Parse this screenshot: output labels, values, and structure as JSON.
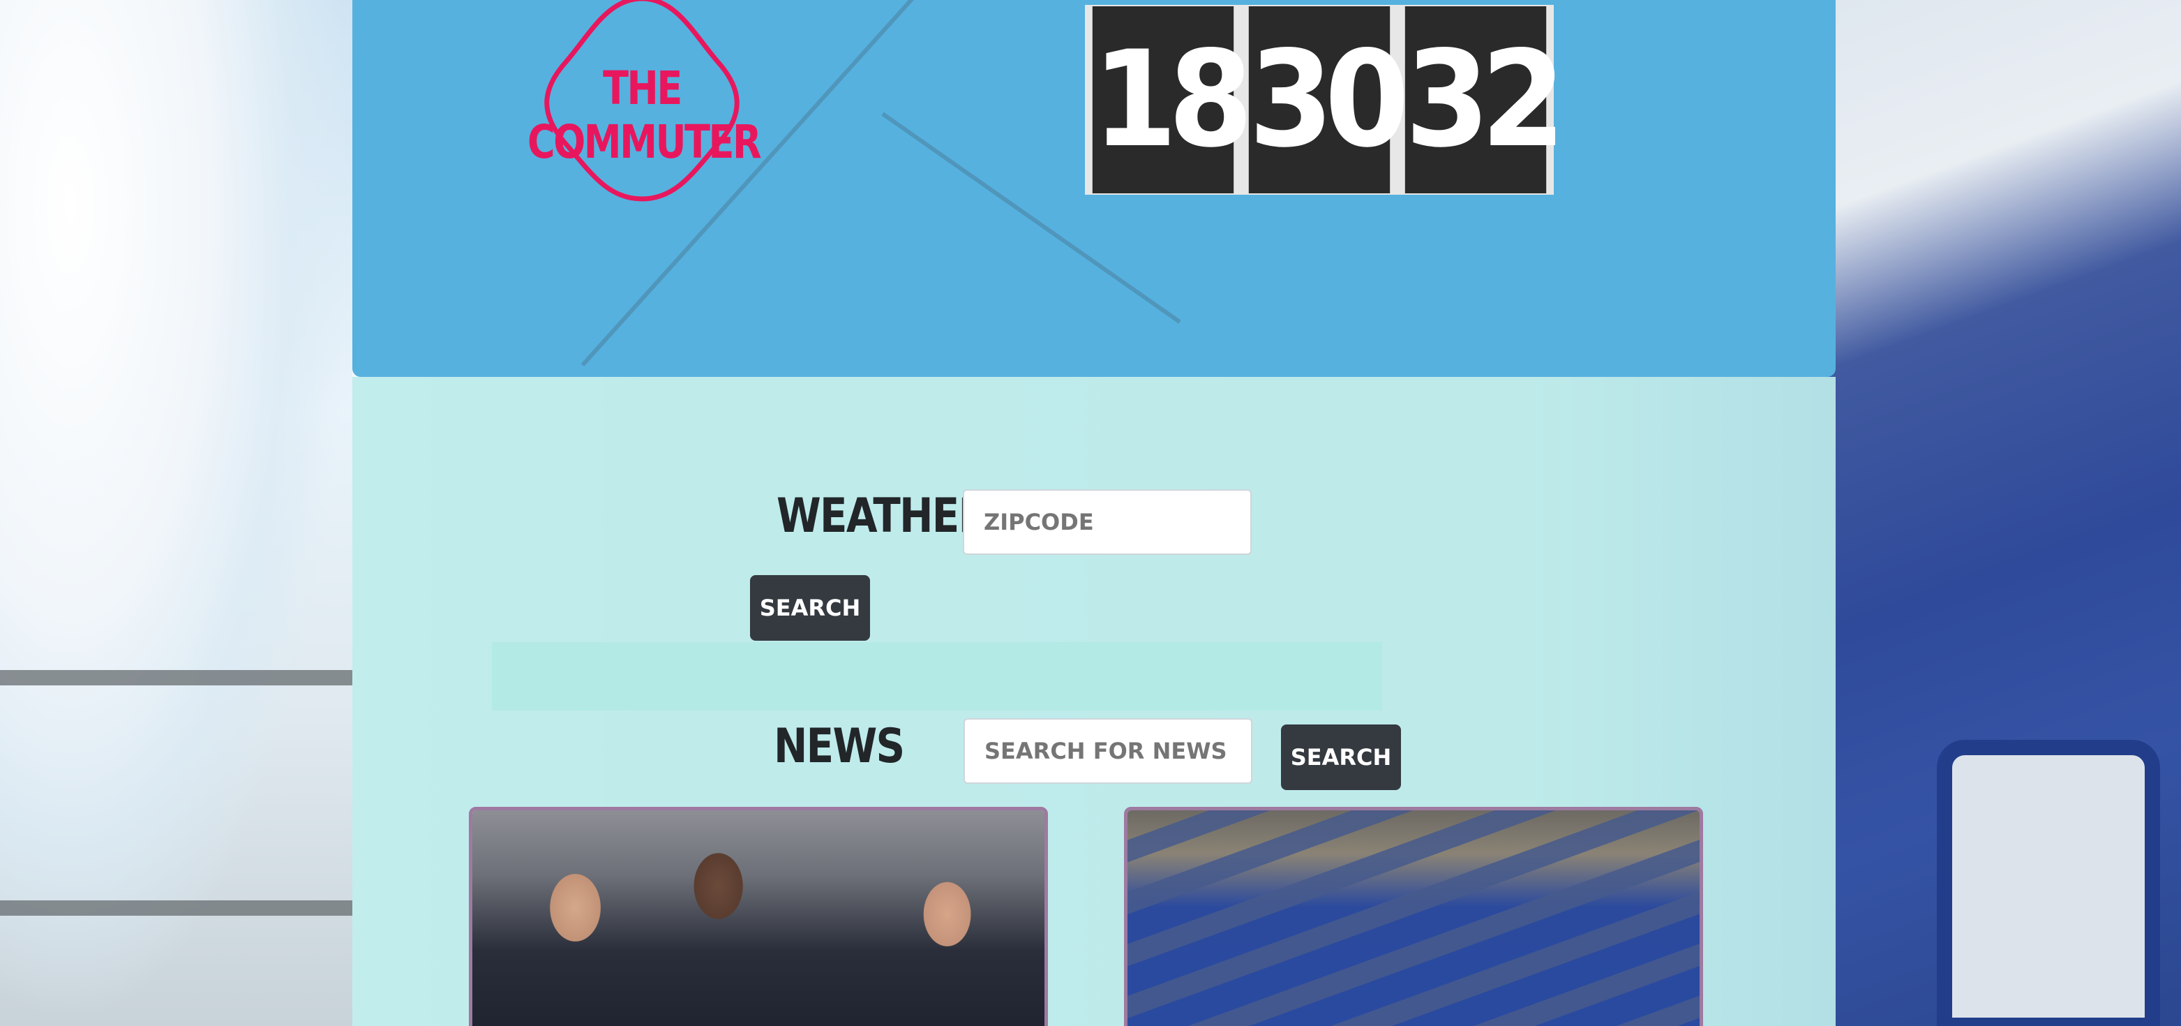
{
  "header": {
    "logo_text": "THE COMMUTER",
    "clock": [
      "18",
      "30",
      "32"
    ],
    "brand_color": "#e8175d",
    "header_color": "#56b1df"
  },
  "weather": {
    "heading": "WEATHER",
    "zipcode_placeholder": "ZIPCODE",
    "search_label": "SEARCH"
  },
  "news": {
    "heading": "NEWS",
    "search_placeholder": "SEARCH FOR NEWS",
    "search_label": "SEARCH",
    "articles": [
      {
        "image": "basketball-bench-photo"
      },
      {
        "image": "coffins-burial-photo"
      }
    ]
  }
}
